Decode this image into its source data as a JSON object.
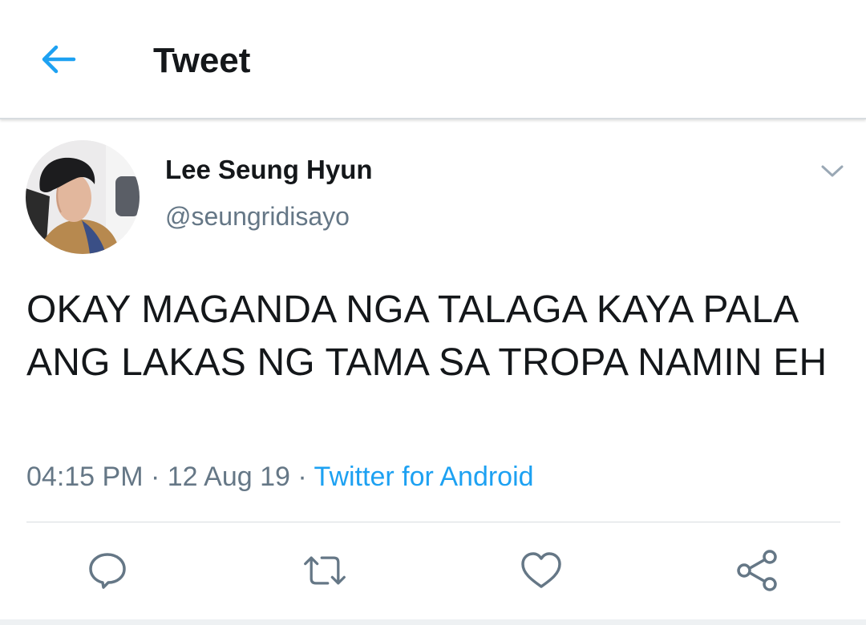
{
  "header": {
    "title": "Tweet",
    "back_icon": "back-arrow-icon",
    "accent_color": "#1da1f2"
  },
  "tweet": {
    "author": {
      "display_name": "Lee Seung Hyun",
      "handle": "@seungridisayo"
    },
    "text": "OKAY MAGANDA NGA TALAGA KAYA PALA ANG LAKAS NG TAMA SA TROPA NAMIN EH",
    "time": "04:15 PM",
    "separator": "·",
    "date": "12 Aug 19",
    "source": "Twitter for Android"
  },
  "actions": [
    {
      "name": "reply",
      "icon": "reply-icon"
    },
    {
      "name": "retweet",
      "icon": "retweet-icon"
    },
    {
      "name": "like",
      "icon": "heart-icon"
    },
    {
      "name": "share",
      "icon": "share-icon"
    }
  ],
  "colors": {
    "text_primary": "#14171a",
    "text_secondary": "#657786",
    "link": "#1da1f2"
  }
}
